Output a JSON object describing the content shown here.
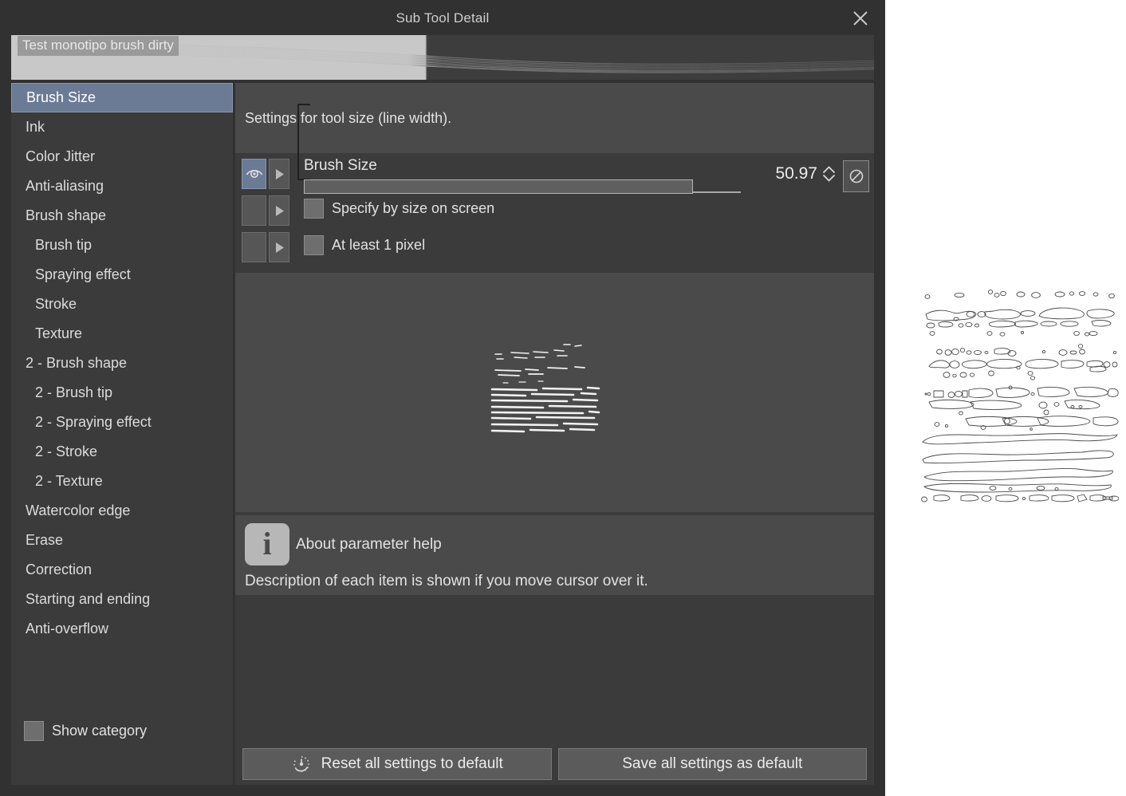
{
  "window": {
    "title": "Sub Tool Detail",
    "close_icon": "close-icon"
  },
  "brush_preview": {
    "name": "Test monotipo brush dirty"
  },
  "sidebar": {
    "items": [
      {
        "label": "Brush Size",
        "indent": false,
        "selected": true
      },
      {
        "label": "Ink",
        "indent": false,
        "selected": false
      },
      {
        "label": "Color Jitter",
        "indent": false,
        "selected": false
      },
      {
        "label": "Anti-aliasing",
        "indent": false,
        "selected": false
      },
      {
        "label": "Brush shape",
        "indent": false,
        "selected": false
      },
      {
        "label": "Brush tip",
        "indent": true,
        "selected": false
      },
      {
        "label": "Spraying effect",
        "indent": true,
        "selected": false
      },
      {
        "label": "Stroke",
        "indent": true,
        "selected": false
      },
      {
        "label": "Texture",
        "indent": true,
        "selected": false
      },
      {
        "label": "2 - Brush shape",
        "indent": false,
        "selected": false
      },
      {
        "label": "2 - Brush tip",
        "indent": true,
        "selected": false
      },
      {
        "label": "2 - Spraying effect",
        "indent": true,
        "selected": false
      },
      {
        "label": "2 - Stroke",
        "indent": true,
        "selected": false
      },
      {
        "label": "2 - Texture",
        "indent": true,
        "selected": false
      },
      {
        "label": "Watercolor edge",
        "indent": false,
        "selected": false
      },
      {
        "label": "Erase",
        "indent": false,
        "selected": false
      },
      {
        "label": "Correction",
        "indent": false,
        "selected": false
      },
      {
        "label": "Starting and ending",
        "indent": false,
        "selected": false
      },
      {
        "label": "Anti-overflow",
        "indent": false,
        "selected": false
      }
    ],
    "show_category": {
      "label": "Show category",
      "checked": false
    }
  },
  "panel": {
    "description": "Settings for tool size (line width).",
    "brush_size": {
      "label": "Brush Size",
      "value": "50.97",
      "slider_percent": 89,
      "eye_icon": "eye-icon",
      "expand_icon": "triangle-right-icon",
      "spin_up_icon": "chevron-up-icon",
      "spin_down_icon": "chevron-down-icon",
      "reset_icon": "circle-slash-icon",
      "eye_active": true
    },
    "options": [
      {
        "label": "Specify by size on screen",
        "checked": false
      },
      {
        "label": "At least 1 pixel",
        "checked": false
      }
    ],
    "help": {
      "icon": "info-icon",
      "title": "About parameter help",
      "description": "Description of each item is shown if you move cursor over it."
    },
    "footer": {
      "reset_label": "Reset all settings to default",
      "reset_icon": "clock-reset-icon",
      "save_label": "Save all settings as default"
    }
  },
  "colors": {
    "window_bg": "#313131",
    "panel_bg": "#3b3b3b",
    "field_bg": "#4a4a4a",
    "accent_selected": "#6b7a95",
    "text": "#e2e2e2"
  }
}
